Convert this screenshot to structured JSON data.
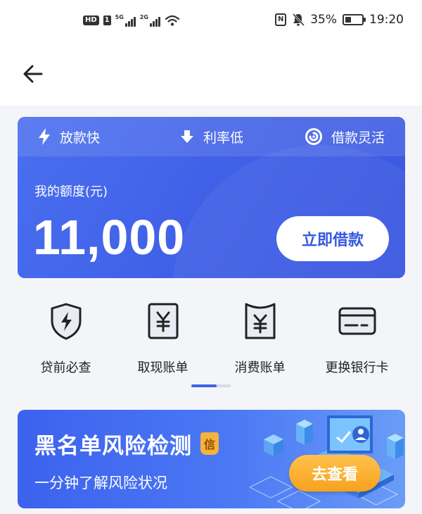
{
  "status_bar": {
    "hd_label": "HD",
    "sim_label": "1",
    "net1_label": "5G",
    "net2_label": "2G",
    "nfc_label": "N",
    "battery_text": "35%",
    "battery_level": 0.35,
    "time": "19:20"
  },
  "credit": {
    "features": [
      {
        "label": "放款快",
        "icon": "lightning-icon"
      },
      {
        "label": "利率低",
        "icon": "down-arrow-icon"
      },
      {
        "label": "借款灵活",
        "icon": "swirl-icon"
      }
    ],
    "quota_label": "我的额度(元)",
    "quota_value": "11,000",
    "borrow_button": "立即借款"
  },
  "quick_menu": [
    {
      "label": "贷前必查",
      "icon": "shield-lightning-icon"
    },
    {
      "label": "取现账单",
      "icon": "yuan-bill-icon"
    },
    {
      "label": "消费账单",
      "icon": "yuan-receipt-icon"
    },
    {
      "label": "更换银行卡",
      "icon": "bank-card-icon"
    }
  ],
  "pager": {
    "pages": 2,
    "current": 1
  },
  "banner": {
    "title": "黑名单风险检测",
    "badge": "信",
    "subtitle": "一分钟了解风险状况",
    "button": "去查看"
  },
  "colors": {
    "primary": "#3f5fe6",
    "accent_orange": "#f7a21c",
    "background": "#f4f5f9"
  }
}
